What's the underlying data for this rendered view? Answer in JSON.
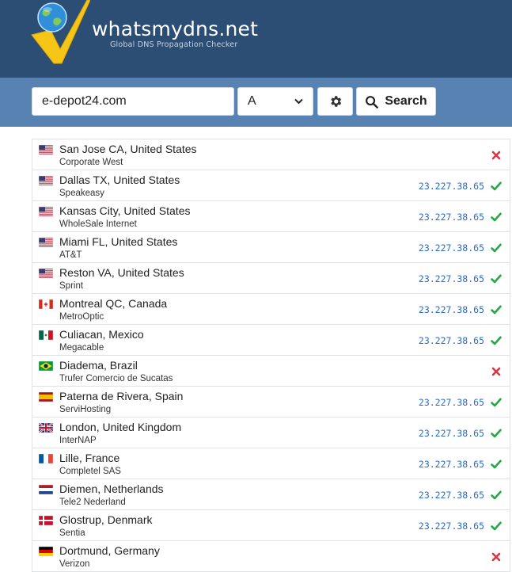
{
  "logo": {
    "title": "whatsmydns.net",
    "subtitle": "Global DNS Propagation Checker",
    "icon": "globe-checkmark-icon"
  },
  "search": {
    "domain_value": "e-depot24.com",
    "record_type": "A",
    "search_label": "Search",
    "settings_icon": "gear-icon",
    "search_icon": "magnifier-icon"
  },
  "colors": {
    "header_bg": "#2c4e74",
    "bar_bg": "#5882b2",
    "ok": "#28a745",
    "fail": "#dc3545",
    "ip": "#2a6bc8"
  },
  "results": [
    {
      "location": "San Jose CA, United States",
      "isp": "Corporate West",
      "ip": "",
      "status": "fail",
      "flag": "us"
    },
    {
      "location": "Dallas TX, United States",
      "isp": "Speakeasy",
      "ip": "23.227.38.65",
      "status": "ok",
      "flag": "us"
    },
    {
      "location": "Kansas City, United States",
      "isp": "WholeSale Internet",
      "ip": "23.227.38.65",
      "status": "ok",
      "flag": "us"
    },
    {
      "location": "Miami FL, United States",
      "isp": "AT&T",
      "ip": "23.227.38.65",
      "status": "ok",
      "flag": "us"
    },
    {
      "location": "Reston VA, United States",
      "isp": "Sprint",
      "ip": "23.227.38.65",
      "status": "ok",
      "flag": "us"
    },
    {
      "location": "Montreal QC, Canada",
      "isp": "MetroOptic",
      "ip": "23.227.38.65",
      "status": "ok",
      "flag": "ca"
    },
    {
      "location": "Culiacan, Mexico",
      "isp": "Megacable",
      "ip": "23.227.38.65",
      "status": "ok",
      "flag": "mx"
    },
    {
      "location": "Diadema, Brazil",
      "isp": "Trufer Comercio de Sucatas",
      "ip": "",
      "status": "fail",
      "flag": "br"
    },
    {
      "location": "Paterna de Rivera, Spain",
      "isp": "ServiHosting",
      "ip": "23.227.38.65",
      "status": "ok",
      "flag": "es"
    },
    {
      "location": "London, United Kingdom",
      "isp": "InterNAP",
      "ip": "23.227.38.65",
      "status": "ok",
      "flag": "gb"
    },
    {
      "location": "Lille, France",
      "isp": "Completel SAS",
      "ip": "23.227.38.65",
      "status": "ok",
      "flag": "fr"
    },
    {
      "location": "Diemen, Netherlands",
      "isp": "Tele2 Nederland",
      "ip": "23.227.38.65",
      "status": "ok",
      "flag": "nl"
    },
    {
      "location": "Glostrup, Denmark",
      "isp": "Sentia",
      "ip": "23.227.38.65",
      "status": "ok",
      "flag": "dk"
    },
    {
      "location": "Dortmund, Germany",
      "isp": "Verizon",
      "ip": "",
      "status": "fail",
      "flag": "de"
    }
  ]
}
